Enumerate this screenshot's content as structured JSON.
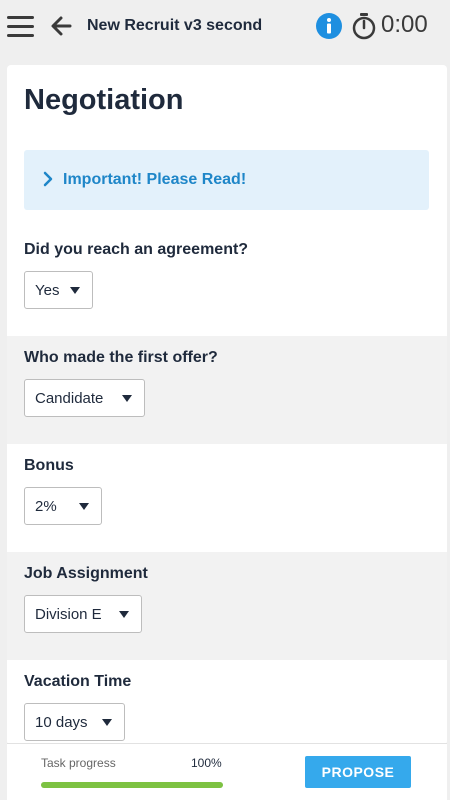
{
  "header": {
    "title": "New Recruit v3 second",
    "timer": "0:00",
    "menu_icon": "hamburger-menu-icon",
    "back_icon": "arrow-left-icon",
    "info_icon": "info-icon",
    "timer_icon": "stopwatch-icon"
  },
  "page": {
    "title": "Negotiation",
    "notice": "Important! Please Read!"
  },
  "questions": [
    {
      "label": "Did you reach an agreement?",
      "value": "Yes"
    },
    {
      "label": "Who made the first offer?",
      "value": "Candidate"
    },
    {
      "label": "Bonus",
      "value": "2%"
    },
    {
      "label": "Job Assignment",
      "value": "Division E"
    },
    {
      "label": "Vacation Time",
      "value": "10 days"
    }
  ],
  "footer": {
    "progress_label": "Task progress",
    "progress_pct": "100%",
    "progress_value": 1.0,
    "propose_label": "PROPOSE"
  },
  "colors": {
    "accent": "#35a9ec",
    "info": "#1e86c8",
    "progress": "#7dc242",
    "notice_bg": "#e3f1fb"
  }
}
